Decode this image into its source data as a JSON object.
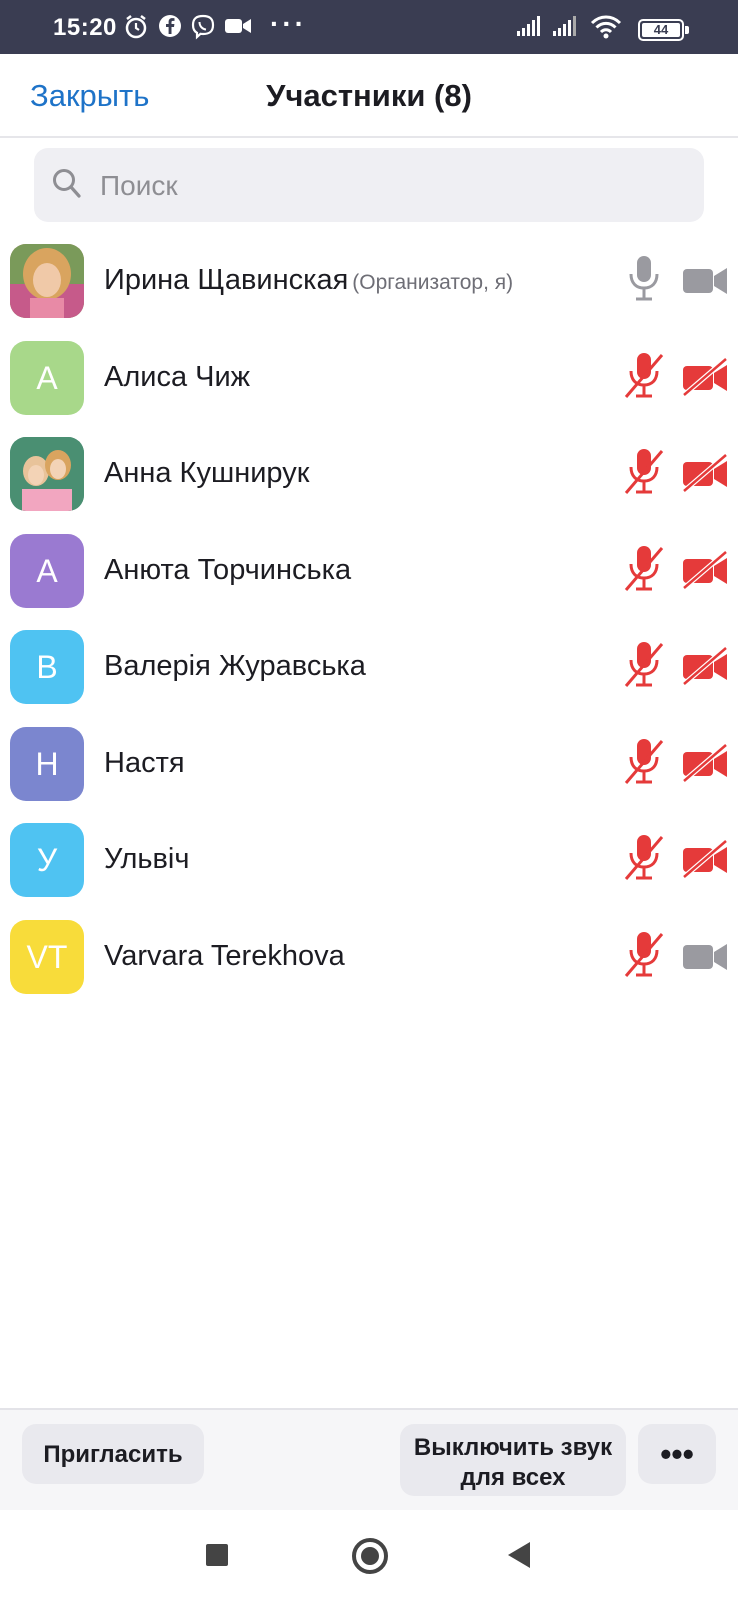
{
  "status_bar": {
    "time": "15:20",
    "battery": "44",
    "icons": [
      "alarm-icon",
      "facebook-icon",
      "viber-icon",
      "video-icon",
      "more-dots-icon",
      "signal-icon",
      "signal-icon",
      "wifi-icon",
      "battery-icon"
    ]
  },
  "header": {
    "close_label": "Закрыть",
    "title": "Участники (8)"
  },
  "search": {
    "placeholder": "Поиск",
    "value": ""
  },
  "participants": [
    {
      "name": "Ирина Щавинская",
      "role": "(Организатор, я)",
      "avatar_type": "photo",
      "avatar_color": "#c98f6e",
      "mic": "on",
      "camera": "off-gray"
    },
    {
      "name": "Алиса Чиж",
      "initials": "А",
      "avatar_type": "initials",
      "avatar_color": "#a8d88a",
      "mic": "muted",
      "camera": "off"
    },
    {
      "name": "Анна Кушнирук",
      "avatar_type": "photo",
      "avatar_color": "#4a8f72",
      "mic": "muted",
      "camera": "off"
    },
    {
      "name": "Анюта Торчинська",
      "initials": "А",
      "avatar_type": "initials",
      "avatar_color": "#9a7ad1",
      "mic": "muted",
      "camera": "off"
    },
    {
      "name": "Валерія Журавська",
      "initials": "В",
      "avatar_type": "initials",
      "avatar_color": "#4fc3f2",
      "mic": "muted",
      "camera": "off"
    },
    {
      "name": "Настя",
      "initials": "Н",
      "avatar_type": "initials",
      "avatar_color": "#7b86cf",
      "mic": "muted",
      "camera": "off"
    },
    {
      "name": "Ульвіч",
      "initials": "У",
      "avatar_type": "initials",
      "avatar_color": "#4fc3f2",
      "mic": "muted",
      "camera": "off"
    },
    {
      "name": "Varvara Terekhova",
      "initials": "VT",
      "avatar_type": "initials",
      "avatar_color": "#f8dc3a",
      "mic": "muted",
      "camera": "off-gray"
    }
  ],
  "toolbar": {
    "invite_label": "Пригласить",
    "mute_all_label": "Выключить звук для всех",
    "more_label": "•••"
  },
  "colors": {
    "accent": "#1e73c8",
    "muted_red": "#e53a3a",
    "icon_gray": "#9a9aa0",
    "status_bar": "#3a3d52"
  }
}
